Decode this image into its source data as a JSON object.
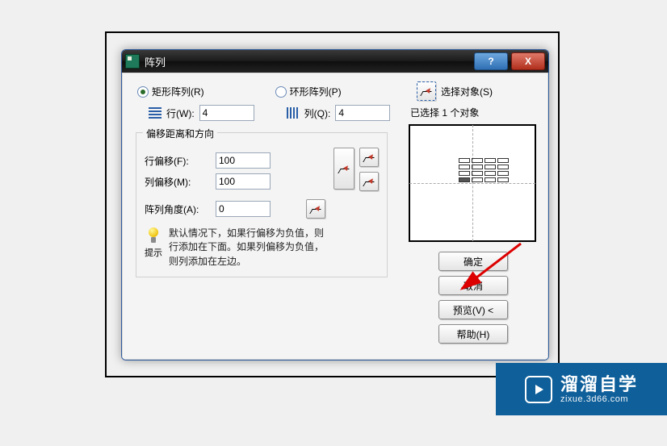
{
  "title": "阵列",
  "radios": {
    "rect": "矩形阵列(R)",
    "polar": "环形阵列(P)",
    "selected": "rect"
  },
  "rows_cols": {
    "rows_label": "行(W):",
    "rows_value": "4",
    "cols_label": "列(Q):",
    "cols_value": "4"
  },
  "groupbox_title": "偏移距离和方向",
  "offsets": {
    "row_label": "行偏移(F):",
    "row_value": "100",
    "col_label": "列偏移(M):",
    "col_value": "100",
    "angle_label": "阵列角度(A):",
    "angle_value": "0"
  },
  "hint": {
    "label": "提示",
    "text": "默认情况下，如果行偏移为负值，则行添加在下面。如果列偏移为负值，则列添加在左边。"
  },
  "select": {
    "button_label": "选择对象(S)",
    "info": "已选择 1 个对象"
  },
  "buttons": {
    "ok": "确定",
    "cancel": "取消",
    "preview": "预览(V) <",
    "help": "帮助(H)"
  },
  "titlebar": {
    "help": "?",
    "close": "X"
  },
  "watermark": {
    "zh": "溜溜自学",
    "en": "zixue.3d66.com"
  },
  "chart_data": {
    "type": "grid-preview",
    "rows": 4,
    "cols": 4,
    "origin_row": 3,
    "origin_col": 0
  }
}
